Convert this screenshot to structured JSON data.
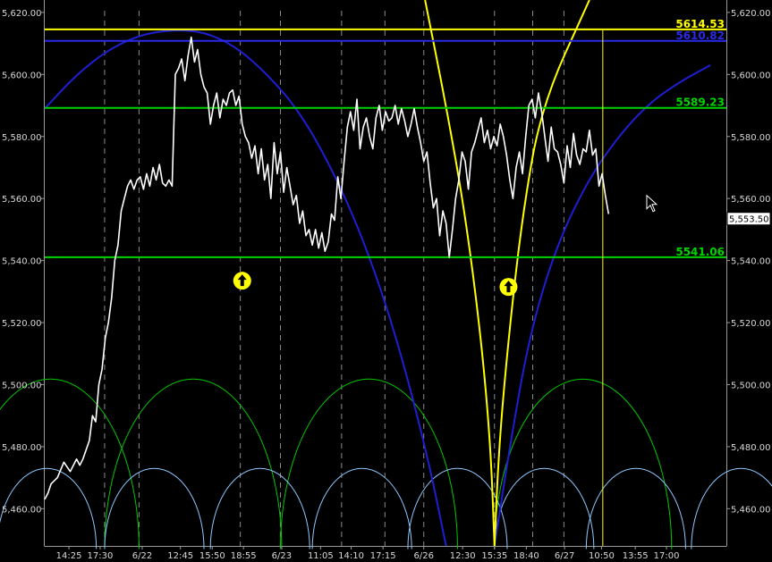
{
  "chart_data": {
    "type": "line",
    "y_axis_side": "both",
    "ylim": [
      5448,
      5624
    ],
    "xlim": [
      0,
      107
    ],
    "y_ticks": [
      {
        "value": 5620,
        "label": "5,620.00"
      },
      {
        "value": 5600,
        "label": "5,600.00"
      },
      {
        "value": 5580,
        "label": "5,580.00"
      },
      {
        "value": 5560,
        "label": "5,560.00"
      },
      {
        "value": 5540,
        "label": "5,540.00"
      },
      {
        "value": 5520,
        "label": "5,520.00"
      },
      {
        "value": 5500,
        "label": "5,500.00"
      },
      {
        "value": 5480,
        "label": "5,480.00"
      },
      {
        "value": 5460,
        "label": "5,460.00"
      }
    ],
    "x_ticks": [
      {
        "x": 3.8,
        "label": "14:25"
      },
      {
        "x": 8.7,
        "label": "17:30"
      },
      {
        "x": 15.3,
        "label": "6/22"
      },
      {
        "x": 21.3,
        "label": "12:45"
      },
      {
        "x": 26.3,
        "label": "15:50"
      },
      {
        "x": 31.2,
        "label": "18:55"
      },
      {
        "x": 37.2,
        "label": "6/23"
      },
      {
        "x": 43.3,
        "label": "11:05"
      },
      {
        "x": 48.1,
        "label": "14:10"
      },
      {
        "x": 53.1,
        "label": "17:15"
      },
      {
        "x": 59.5,
        "label": "6/26"
      },
      {
        "x": 65.6,
        "label": "12:30"
      },
      {
        "x": 70.6,
        "label": "15:35"
      },
      {
        "x": 75.6,
        "label": "18:40"
      },
      {
        "x": 81.6,
        "label": "6/27"
      },
      {
        "x": 87.4,
        "label": "10:50"
      },
      {
        "x": 92.7,
        "label": "13:55"
      },
      {
        "x": 97.6,
        "label": "17:00"
      }
    ],
    "session_dividers_x": [
      9.4,
      14.8,
      30.7,
      37.0,
      46.6,
      53.4,
      59.5,
      70.6,
      76.6,
      81.5
    ],
    "price_series": {
      "name": "price",
      "color": "#ffffff",
      "x": [
        0,
        0.5,
        1,
        2,
        3,
        4,
        5,
        5.5,
        6,
        7,
        7.5,
        8,
        8.5,
        9,
        9.5,
        10,
        10.5,
        11,
        11.5,
        12,
        12.5,
        13,
        13.5,
        14,
        14.5,
        15,
        15.5,
        16,
        16.5,
        17,
        17.5,
        18,
        18.5,
        19,
        19.5,
        20,
        20.5,
        21,
        21.5,
        22,
        22.5,
        23,
        23.5,
        24,
        24.5,
        25,
        25.5,
        26,
        26.5,
        27,
        27.5,
        28,
        28.5,
        29,
        29.5,
        30,
        30.5,
        31,
        31.5,
        32,
        32.5,
        33,
        33.5,
        34,
        34.5,
        35,
        35.5,
        36,
        36.5,
        37,
        37.5,
        38,
        38.5,
        39,
        39.5,
        40,
        40.5,
        41,
        41.5,
        42,
        42.5,
        43,
        43.5,
        44,
        44.5,
        45,
        45.5,
        46,
        46.5,
        47,
        47.5,
        48,
        48.5,
        49,
        49.5,
        50,
        50.5,
        51,
        51.5,
        52,
        52.5,
        53,
        53.5,
        54,
        54.5,
        55,
        55.5,
        56,
        56.5,
        57,
        57.5,
        58,
        58.5,
        59,
        59.5,
        60,
        60.5,
        61,
        61.5,
        62,
        62.5,
        63,
        63.5,
        64,
        64.5,
        65,
        65.5,
        66,
        66.5,
        67,
        67.5,
        68,
        68.5,
        69,
        69.5,
        70,
        70.5,
        71,
        71.5,
        72,
        72.5,
        73,
        73.5,
        74,
        74.5,
        75,
        75.5,
        76,
        76.5,
        77,
        77.5,
        78,
        78.5,
        79,
        79.5,
        80,
        80.5,
        81,
        81.5,
        82,
        82.5,
        83,
        83.5,
        84,
        84.5,
        85,
        85.5,
        86,
        86.5,
        87,
        87.5,
        88,
        88.5
      ],
      "y": [
        5463,
        5465,
        5468,
        5470,
        5475,
        5472,
        5476,
        5474,
        5476,
        5482,
        5490,
        5488,
        5500,
        5505,
        5515,
        5520,
        5528,
        5540,
        5545,
        5556,
        5560,
        5564,
        5566,
        5563,
        5566,
        5567,
        5563,
        5568,
        5564,
        5570,
        5566,
        5571,
        5565,
        5564,
        5566,
        5564,
        5600,
        5602,
        5605,
        5598,
        5606,
        5612,
        5604,
        5608,
        5600,
        5596,
        5594,
        5584,
        5590,
        5594,
        5586,
        5592,
        5590,
        5594,
        5595,
        5590,
        5593,
        5584,
        5580,
        5578,
        5573,
        5577,
        5568,
        5576,
        5566,
        5571,
        5560,
        5578,
        5568,
        5575,
        5562,
        5570,
        5564,
        5558,
        5561,
        5552,
        5556,
        5548,
        5550,
        5545,
        5550,
        5544,
        5549,
        5543,
        5546,
        5555,
        5553,
        5567,
        5560,
        5572,
        5583,
        5588,
        5582,
        5592,
        5576,
        5583,
        5586,
        5580,
        5576,
        5586,
        5590,
        5582,
        5588,
        5585,
        5586,
        5590,
        5584,
        5589,
        5585,
        5580,
        5584,
        5589,
        5583,
        5578,
        5572,
        5575,
        5565,
        5557,
        5560,
        5548,
        5556,
        5552,
        5541,
        5550,
        5560,
        5566,
        5575,
        5572,
        5563,
        5575,
        5578,
        5582,
        5586,
        5578,
        5582,
        5576,
        5580,
        5577,
        5584,
        5580,
        5574,
        5566,
        5560,
        5570,
        5575,
        5568,
        5580,
        5590,
        5592,
        5586,
        5594,
        5588,
        5580,
        5572,
        5583,
        5576,
        5575,
        5571,
        5565,
        5577,
        5570,
        5581,
        5574,
        5571,
        5576,
        5575,
        5582,
        5574,
        5576,
        5564,
        5568,
        5561,
        5555,
        5560,
        5553
      ]
    },
    "horizontal_lines": [
      {
        "value": 5614.53,
        "label": "5614.53",
        "color": "#ffff00"
      },
      {
        "value": 5610.82,
        "label": "5610.82",
        "color": "#2a2ae8"
      },
      {
        "value": 5589.23,
        "label": "5589.23",
        "color": "#00d400"
      },
      {
        "value": 5541.06,
        "label": "5541.06",
        "color": "#00d400"
      }
    ],
    "vertical_marker": {
      "x": 87.6,
      "color": "#ffff00"
    },
    "last_price_label": "5,553.50",
    "last_price_value": 5553.5,
    "up_arrows": [
      {
        "x": 31.0,
        "y": 5533.5,
        "color": "#ffff00"
      },
      {
        "x": 72.8,
        "y": 5531.5,
        "color": "#ffff00"
      }
    ],
    "cursor": {
      "x": 94.5,
      "y": 5561
    },
    "arc_overlays": [
      {
        "name": "",
        "color": "#1e1ed2",
        "points": [
          [
            0,
            5589
          ],
          [
            5,
            5600
          ],
          [
            10,
            5608
          ],
          [
            15,
            5612.8
          ],
          [
            20,
            5614.4
          ],
          [
            25,
            5613.8
          ],
          [
            30,
            5609
          ],
          [
            35,
            5600
          ],
          [
            40,
            5588
          ],
          [
            45,
            5570
          ],
          [
            50,
            5547
          ],
          [
            55,
            5517
          ],
          [
            60,
            5478
          ],
          [
            63,
            5448
          ]
        ]
      },
      {
        "name": "",
        "color": "#1e1ed2",
        "points": [
          [
            70.6,
            5448
          ],
          [
            73,
            5480
          ],
          [
            76,
            5515
          ],
          [
            80,
            5543
          ],
          [
            85,
            5565
          ],
          [
            90,
            5580
          ],
          [
            95,
            5591
          ],
          [
            100,
            5598
          ],
          [
            104.5,
            5603
          ]
        ]
      },
      {
        "name": "",
        "color": "#ffff00",
        "points": [
          [
            59.7,
            5624
          ],
          [
            63,
            5590
          ],
          [
            66,
            5555
          ],
          [
            68.5,
            5515
          ],
          [
            70,
            5480
          ],
          [
            70.6,
            5448
          ]
        ]
      },
      {
        "name": "",
        "color": "#ffff00",
        "points": [
          [
            70.6,
            5448
          ],
          [
            71.3,
            5480
          ],
          [
            72.8,
            5515
          ],
          [
            75,
            5555
          ],
          [
            78,
            5590
          ],
          [
            85.5,
            5624
          ]
        ]
      }
    ],
    "cycle_arcs": [
      {
        "name": "",
        "color": "#00c800",
        "start": [
          -13,
          9.4,
          37.0,
          70.6
        ],
        "width": 27.8,
        "height": 5501.8,
        "base": 5447
      },
      {
        "name": "",
        "color": "#8ec8ff",
        "start": [
          -7.5,
          9.4,
          26.0,
          42.0,
          57.0,
          70.6,
          85.0,
          101.5
        ],
        "width": 15.6,
        "height": 5473,
        "base": 5447
      }
    ]
  }
}
